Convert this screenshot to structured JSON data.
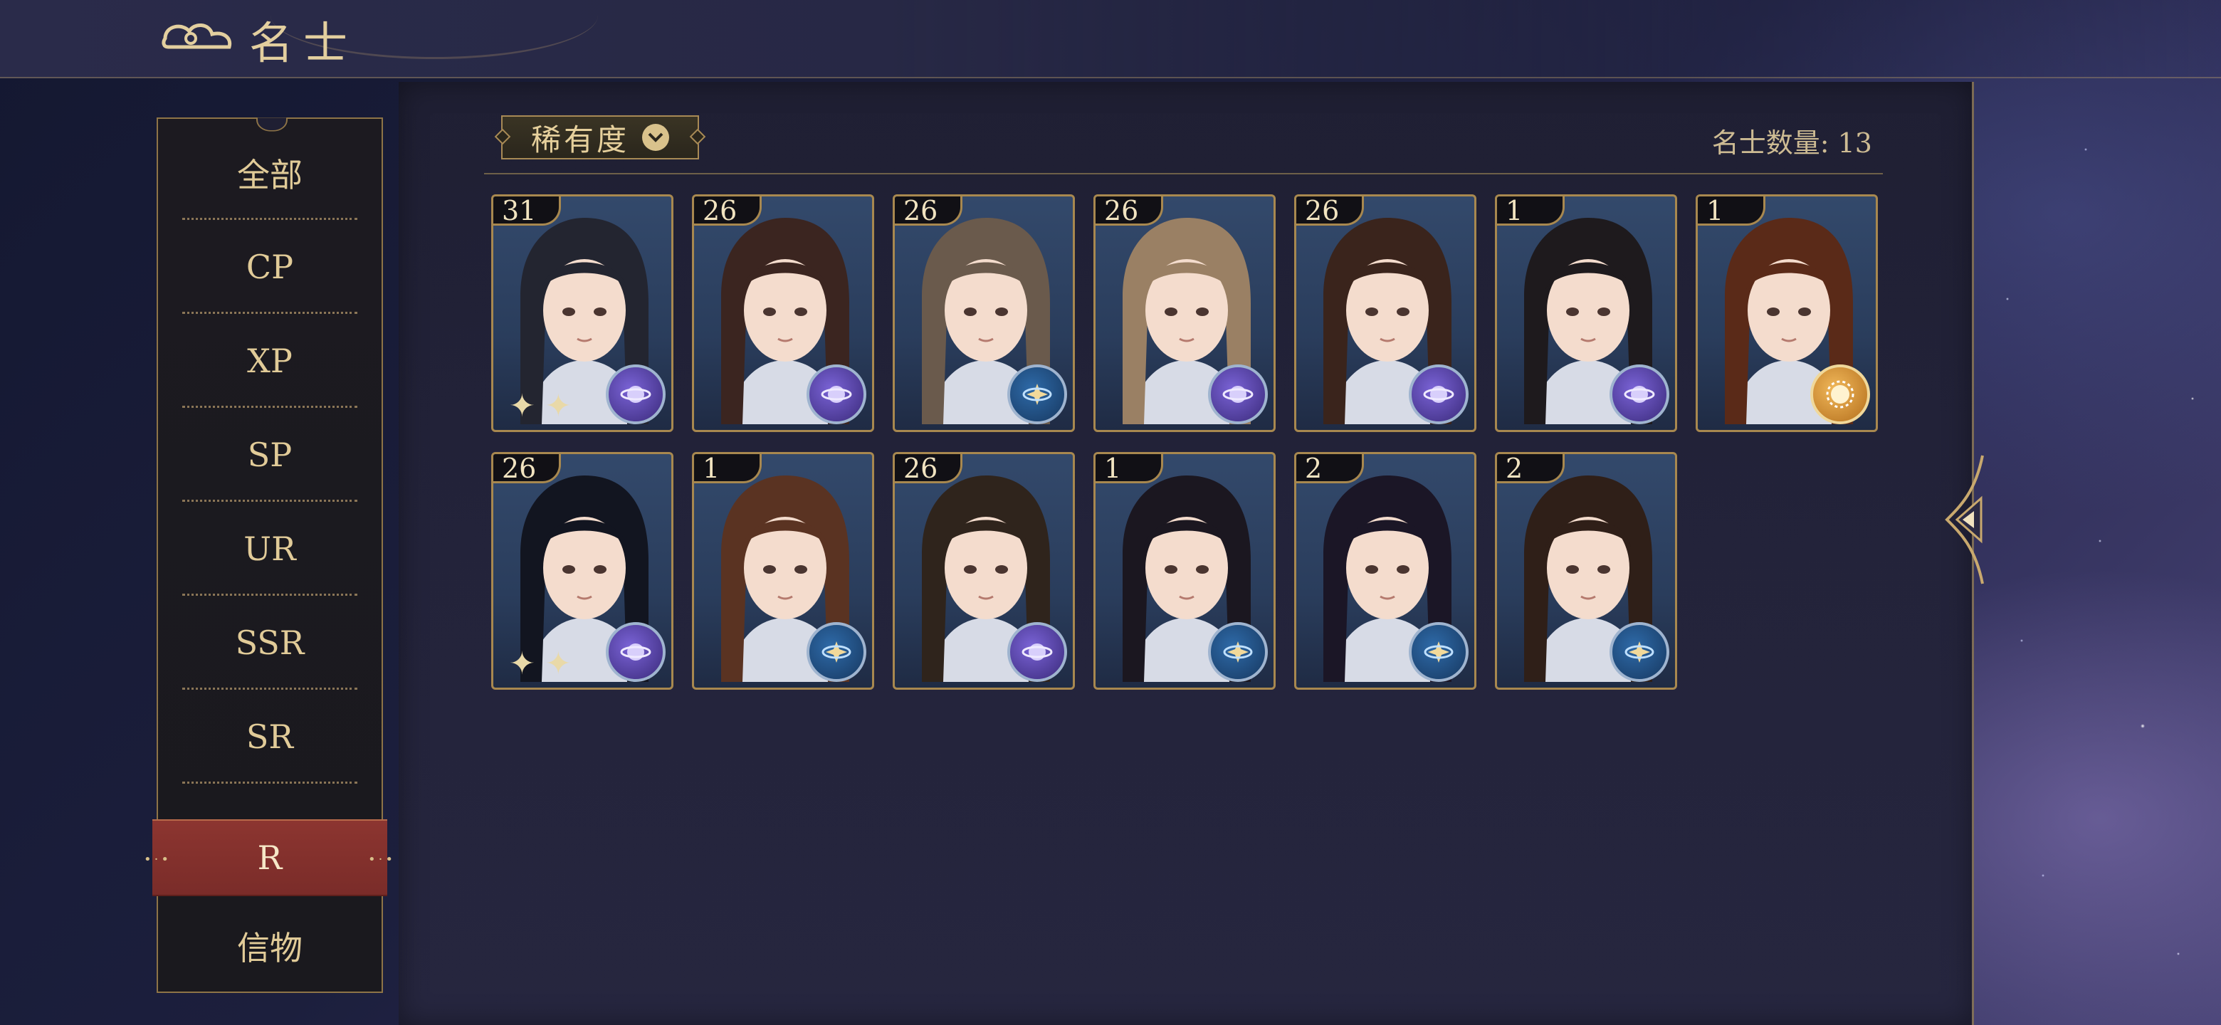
{
  "header": {
    "title": "名士"
  },
  "sidebar": {
    "tabs": [
      {
        "label": "全部"
      },
      {
        "label": "CP"
      },
      {
        "label": "XP"
      },
      {
        "label": "SP"
      },
      {
        "label": "UR"
      },
      {
        "label": "SSR"
      },
      {
        "label": "SR"
      },
      {
        "label": "R",
        "active": true
      },
      {
        "label": "信物"
      }
    ]
  },
  "filter": {
    "label": "稀有度"
  },
  "count": {
    "label": "名士数量: 13"
  },
  "cards": [
    {
      "level": "31",
      "attr": "purple",
      "hair": "#232530",
      "sparkle": "✦ ✦"
    },
    {
      "level": "26",
      "attr": "purple",
      "hair": "#3b2520"
    },
    {
      "level": "26",
      "attr": "blue",
      "hair": "#6a5a4c"
    },
    {
      "level": "26",
      "attr": "purple",
      "hair": "#9a8064"
    },
    {
      "level": "26",
      "attr": "purple",
      "hair": "#3a241c"
    },
    {
      "level": "1",
      "attr": "purple",
      "hair": "#1e1a1d"
    },
    {
      "level": "1",
      "attr": "gold",
      "hair": "#5a2a18"
    },
    {
      "level": "26",
      "attr": "purple",
      "hair": "#121520",
      "sparkle": "✦ ✦"
    },
    {
      "level": "1",
      "attr": "blue",
      "hair": "#5a3322"
    },
    {
      "level": "26",
      "attr": "purple",
      "hair": "#2f241c"
    },
    {
      "level": "1",
      "attr": "blue",
      "hair": "#1b1720"
    },
    {
      "level": "2",
      "attr": "blue",
      "hair": "#1b1626"
    },
    {
      "level": "2",
      "attr": "blue",
      "hair": "#2f1f18"
    }
  ],
  "colors": {
    "accent_gold": "#c9a96e",
    "active_tab": "#7f302b",
    "panel": "#23233a"
  }
}
